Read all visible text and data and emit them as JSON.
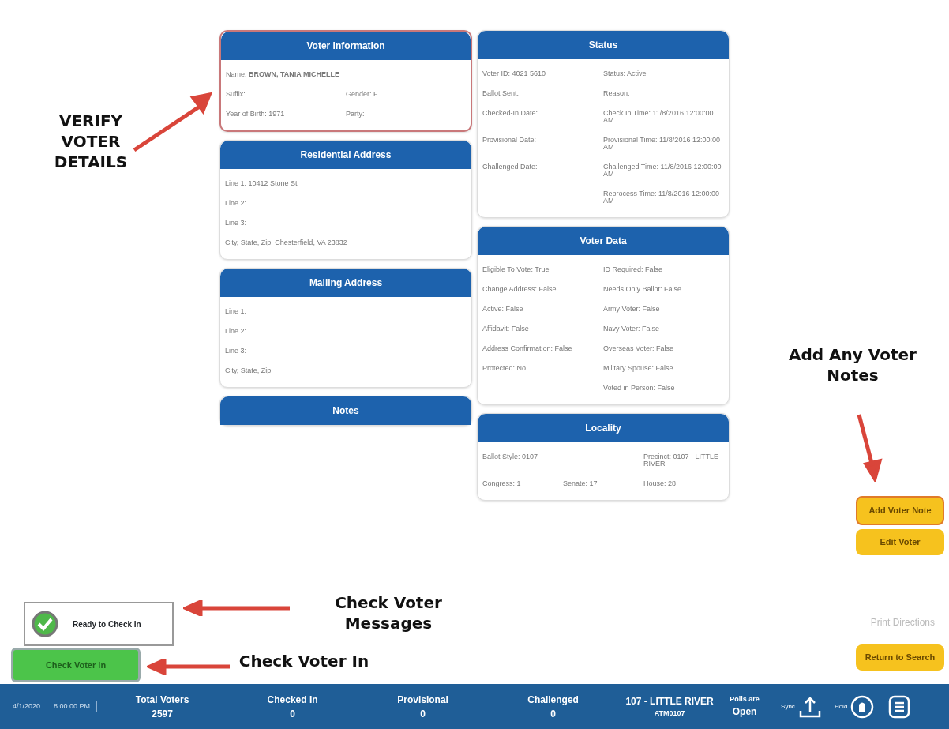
{
  "callouts": {
    "verify_details": "VERIFY VOTER DETAILS",
    "add_notes": "Add Any Voter Notes",
    "check_messages": "Check Voter Messages",
    "check_in": "Check Voter In"
  },
  "left_cards": [
    {
      "title": "Voter Information",
      "highlighted": true,
      "rows": [
        [
          "Name: **BROWN, TANIA MICHELLE**"
        ],
        [
          "Suffix:",
          "Gender: F"
        ],
        [
          "Year of Birth: 1971",
          "Party:"
        ]
      ]
    },
    {
      "title": "Residential Address",
      "highlighted": false,
      "rows": [
        [
          "Line 1: 10412 Stone St"
        ],
        [
          "Line 2:"
        ],
        [
          "Line 3:"
        ],
        [
          "City, State, Zip: Chesterfield, VA 23832"
        ]
      ]
    },
    {
      "title": "Mailing Address",
      "highlighted": false,
      "rows": [
        [
          "Line 1:"
        ],
        [
          "Line 2:"
        ],
        [
          "Line 3:"
        ],
        [
          "City, State, Zip:"
        ]
      ]
    },
    {
      "title": "Notes",
      "highlighted": false
    }
  ],
  "right_cards": [
    {
      "title": "Status",
      "highlighted": false,
      "rows": [
        [
          "Voter ID: 4021 5610",
          "Status: Active"
        ],
        [
          "Ballot Sent:",
          "Reason:"
        ],
        [
          "Checked-In Date:",
          "Check In Time: 11/8/2016 12:00:00 AM"
        ],
        [
          "Provisional Date:",
          "Provisional Time: 11/8/2016 12:00:00 AM"
        ],
        [
          "Challenged Date:",
          "Challenged Time: 11/8/2016 12:00:00 AM"
        ],
        [
          "",
          "Reprocess Time: 11/8/2016 12:00:00 AM"
        ]
      ]
    },
    {
      "title": "Voter Data",
      "highlighted": false,
      "rows": [
        [
          "Eligible To Vote: True",
          "ID Required: False"
        ],
        [
          "Change Address: False",
          "Needs Only Ballot: False"
        ],
        [
          "Active: False",
          "Army Voter: False"
        ],
        [
          "Affidavit: False",
          "Navy Voter: False"
        ],
        [
          "Address Confirmation: False",
          "Overseas Voter: False"
        ],
        [
          "Protected: No",
          "Military Spouse: False"
        ],
        [
          "",
          "Voted in Person: False"
        ]
      ]
    },
    {
      "title": "Locality",
      "highlighted": false,
      "rows": [
        [
          "Ballot Style: 0107",
          "",
          "Precinct: 0107 - LITTLE RIVER"
        ],
        [
          "Congress: 1",
          "Senate: 17",
          "House: 28"
        ]
      ]
    }
  ],
  "side_buttons": [
    {
      "label": "Add Voter Note",
      "kind": "outlined"
    },
    {
      "label": "Edit Voter",
      "kind": "plain"
    }
  ],
  "message": {
    "text": "Ready to Check In",
    "ok": true
  },
  "print_button": {
    "label": "Print Directions",
    "disabled": true
  },
  "checkin_button": {
    "label": "Check Voter In"
  },
  "return_button": {
    "label": "Return to Search"
  },
  "status_bar": {
    "date": "4/1/2020",
    "time": "8:00:00 PM",
    "stats": [
      {
        "label": "Total Voters",
        "value": "2597"
      },
      {
        "label": "Checked In",
        "value": "0"
      },
      {
        "label": "Provisional",
        "value": "0"
      },
      {
        "label": "Challenged",
        "value": "0"
      }
    ],
    "location": "107 - LITTLE RIVER",
    "location_code": "ATM0107",
    "polls_label": "Polls are",
    "polls_status": "Open",
    "upload_label": "Sync",
    "hold_label": "Hold"
  }
}
